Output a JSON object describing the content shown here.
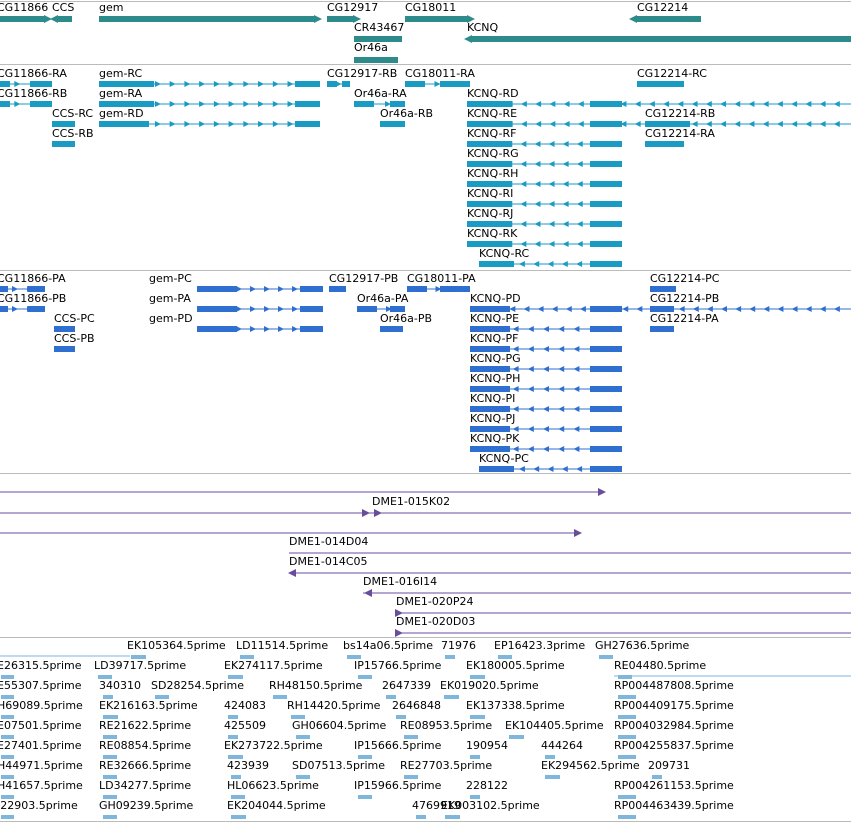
{
  "colors": {
    "gene": "#2e8b8b",
    "transcript": "#1a9bc4",
    "protein": "#2e6fd0",
    "clone": "#6a4c9c",
    "est": "#7fb6dc",
    "separator": "#bbbbbb"
  },
  "tracks": {
    "genes": {
      "labels": [
        "CG11866",
        "CCS",
        "gem",
        "CG12917",
        "CG18011",
        "CG12214",
        "CR43467",
        "Or46a",
        "KCNQ"
      ]
    },
    "transcripts": {
      "labels": [
        "CG11866-RA",
        "gem-RC",
        "CG12917-RB",
        "CG18011-RA",
        "CG12214-RC",
        "CG11866-RB",
        "gem-RA",
        "Or46a-RA",
        "KCNQ-RD",
        "CCS-RC",
        "gem-RD",
        "Or46a-RB",
        "KCNQ-RE",
        "CG12214-RB",
        "CCS-RB",
        "KCNQ-RF",
        "CG12214-RA",
        "KCNQ-RG",
        "KCNQ-RH",
        "KCNQ-RI",
        "KCNQ-RJ",
        "KCNQ-RK",
        "KCNQ-RC"
      ]
    },
    "proteins": {
      "labels": [
        "CG11866-PA",
        "gem-PC",
        "CG12917-PB",
        "CG18011-PA",
        "CG12214-PC",
        "CG11866-PB",
        "gem-PA",
        "Or46a-PA",
        "KCNQ-PD",
        "CG12214-PB",
        "CCS-PC",
        "gem-PD",
        "Or46a-PB",
        "KCNQ-PE",
        "CG12214-PA",
        "CCS-PB",
        "KCNQ-PF",
        "KCNQ-PG",
        "KCNQ-PH",
        "KCNQ-PI",
        "KCNQ-PJ",
        "KCNQ-PK",
        "KCNQ-PC"
      ]
    },
    "clones": {
      "labels": [
        "DME1-015K02",
        "DME1-014D04",
        "DME1-014C05",
        "DME1-016I14",
        "DME1-020P24",
        "DME1-020D03"
      ]
    },
    "ests": {
      "labels": [
        "EK105364.5prime",
        "LD11514.5prime",
        "bs14a06.5prime",
        "71976",
        "EP16423.3prime",
        "GH27636.5prime",
        "E26315.5prime",
        "LD39717.5prime",
        "EK274117.5prime",
        "IP15766.5prime",
        "EK180005.5prime",
        "RE04480.5prime",
        "E55307.5prime",
        "340310",
        "SD28254.5prime",
        "RH48150.5prime",
        "2647339",
        "EK019020.5prime",
        "RP004487808.5prime",
        "H69089.5prime",
        "EK216163.5prime",
        "424083",
        "RH14420.5prime",
        "2646848",
        "EK137338.5prime",
        "RP004409175.5prime",
        "E07501.5prime",
        "RE21622.5prime",
        "425509",
        "GH06604.5prime",
        "RE08953.5prime",
        "EK104405.5prime",
        "RP004032984.5prime",
        "E27401.5prime",
        "RE08854.5prime",
        "EK273722.5prime",
        "IP15666.5prime",
        "190954",
        "444264",
        "RP004255837.5prime",
        "H44971.5prime",
        "RE32666.5prime",
        "423939",
        "SD07513.5prime",
        "RE27703.5prime",
        "EK294562.5prime",
        "209731",
        "H41657.5prime",
        "LD34277.5prime",
        "HL06623.5prime",
        "IP15966.5prime",
        "228122",
        "RP004261153.5prime",
        "I22903.5prime",
        "GH09239.5prime",
        "EK204044.5prime",
        "4769919",
        "EK003102.5prime",
        "RP004463439.5prime"
      ]
    }
  }
}
